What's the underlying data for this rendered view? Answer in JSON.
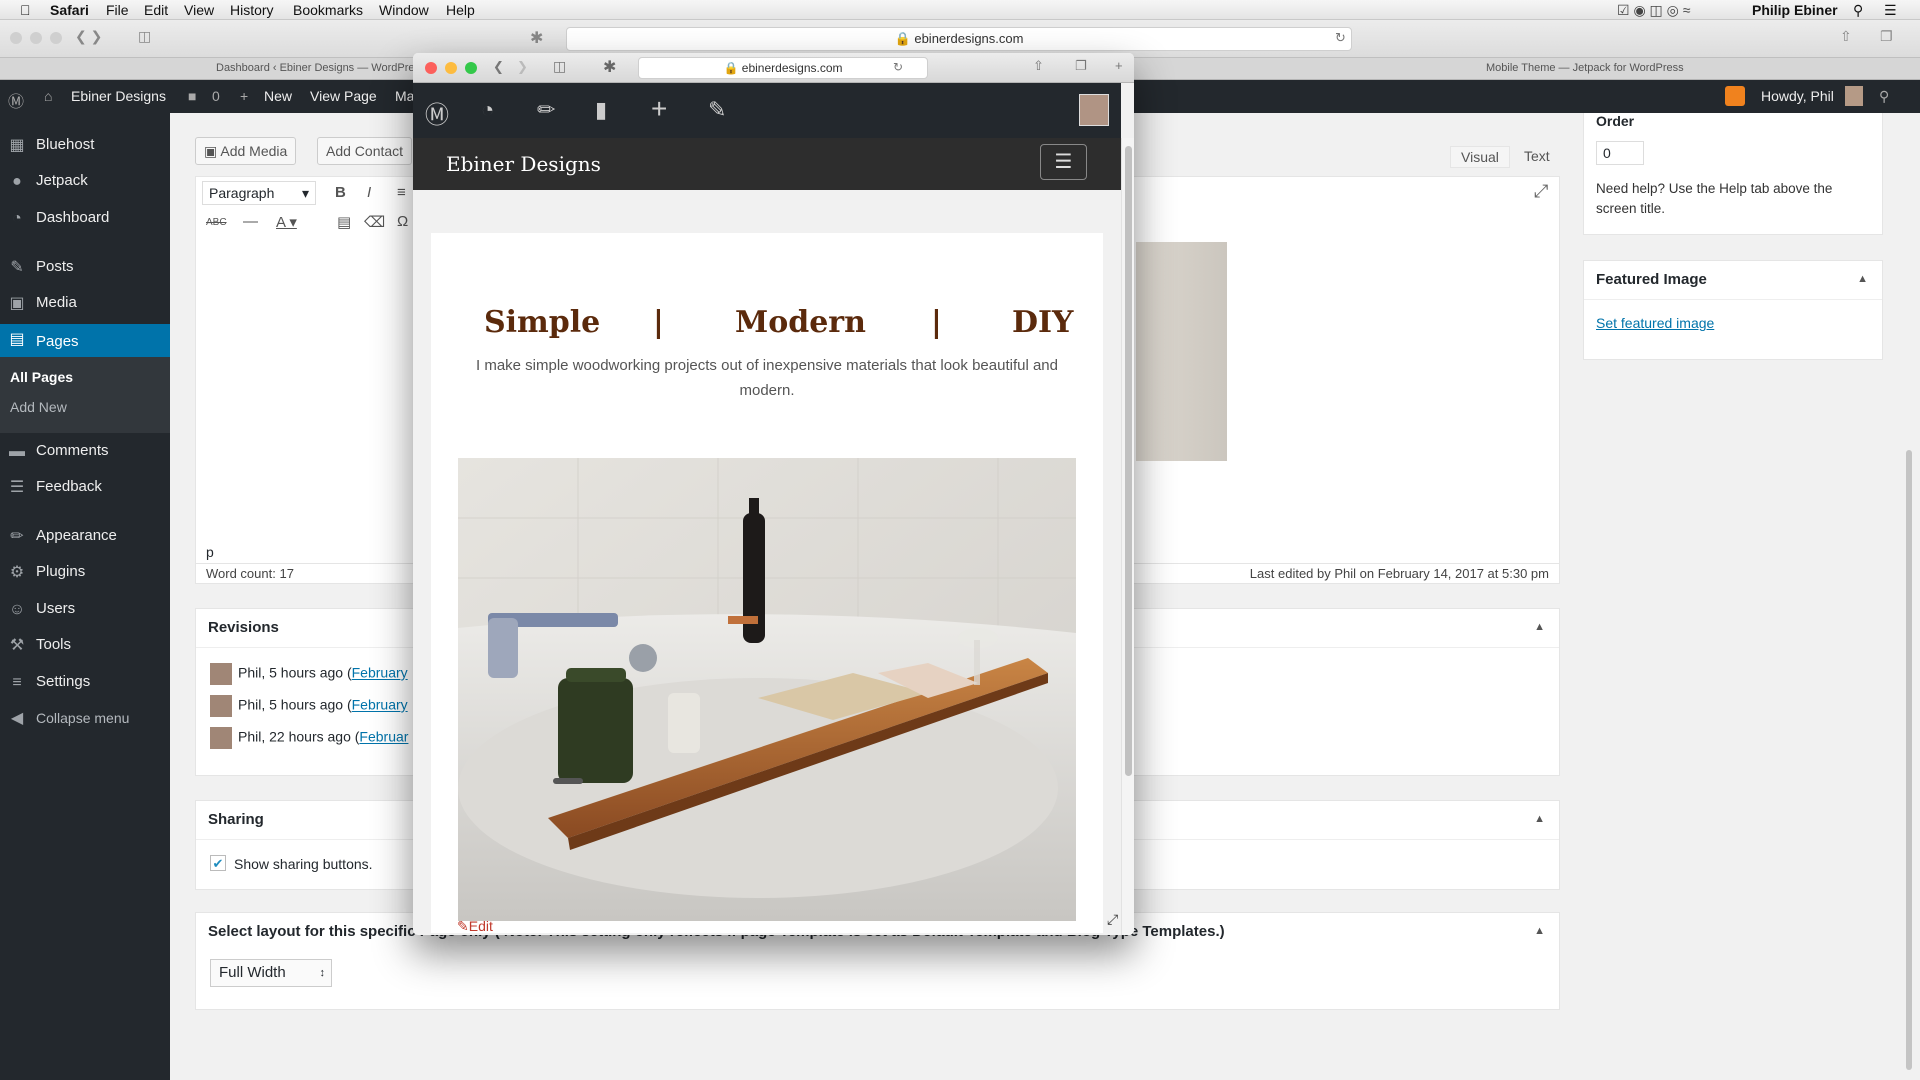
{
  "menubar": {
    "app": "Safari",
    "items": [
      "File",
      "Edit",
      "View",
      "History",
      "Bookmarks",
      "Window",
      "Help"
    ],
    "user": "Philip Ebiner"
  },
  "safari": {
    "url": "ebinerdesigns.com",
    "tab_left": "Dashboard ‹ Ebiner Designs — WordPre...",
    "tab_right": "Mobile Theme — Jetpack for WordPress"
  },
  "adminbar": {
    "site": "Ebiner Designs",
    "comments": "0",
    "new": "New",
    "view_page": "View Page",
    "ma": "Ma",
    "howdy": "Howdy, Phil"
  },
  "sidebar": {
    "items": [
      {
        "label": "Bluehost",
        "icon": "▦"
      },
      {
        "label": "Jetpack",
        "icon": "●"
      },
      {
        "label": "Dashboard",
        "icon": "◔"
      },
      {
        "label": "Posts",
        "icon": "✎"
      },
      {
        "label": "Media",
        "icon": "▣"
      },
      {
        "label": "Pages",
        "icon": "▤"
      },
      {
        "label": "Comments",
        "icon": "▬"
      },
      {
        "label": "Feedback",
        "icon": "☰"
      },
      {
        "label": "Appearance",
        "icon": "✏"
      },
      {
        "label": "Plugins",
        "icon": "⚙"
      },
      {
        "label": "Users",
        "icon": "☺"
      },
      {
        "label": "Tools",
        "icon": "⚒"
      },
      {
        "label": "Settings",
        "icon": "≡"
      },
      {
        "label": "Collapse menu",
        "icon": "◀"
      }
    ],
    "submenu": [
      "All Pages",
      "Add New"
    ]
  },
  "editor": {
    "add_media": "Add Media",
    "add_contact": "Add Contact",
    "tab_visual": "Visual",
    "tab_text": "Text",
    "format": "Paragraph",
    "path": "p",
    "word_count": "Word count: 17",
    "last_edited": "Last edited by Phil on February 14, 2017 at 5:30 pm"
  },
  "revisions": {
    "title": "Revisions",
    "rows": [
      {
        "who": "Phil, 5 hours ago (",
        "link": "February"
      },
      {
        "who": "Phil, 5 hours ago (",
        "link": "February"
      },
      {
        "who": "Phil, 22 hours ago (",
        "link": "Februar"
      }
    ]
  },
  "sharing": {
    "title": "Sharing",
    "checkbox": "Show sharing buttons."
  },
  "layout": {
    "title": "Select layout for this specific Page only ( Note: This setting only reflects if page Template is set as Default Template and Blog Type Templates.)",
    "select": "Full Width"
  },
  "right_panel": {
    "order_label": "Order",
    "order_value": "0",
    "help": "Need help? Use the Help tab above the screen title.",
    "featured_title": "Featured Image",
    "featured_link": "Set featured image"
  },
  "popup": {
    "url": "ebinerdesigns.com",
    "site_title": "Ebiner Designs",
    "hero": [
      "Simple",
      "|",
      "Modern",
      "|",
      "DIY"
    ],
    "tagline": "I make simple woodworking projects out of inexpensive materials that look beautiful and modern.",
    "edit": "Edit"
  }
}
